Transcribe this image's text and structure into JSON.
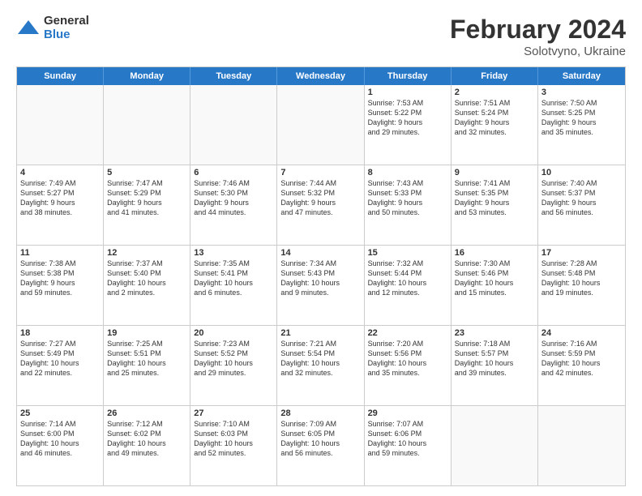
{
  "logo": {
    "general": "General",
    "blue": "Blue"
  },
  "title": {
    "month": "February 2024",
    "location": "Solotvyno, Ukraine"
  },
  "header_days": [
    "Sunday",
    "Monday",
    "Tuesday",
    "Wednesday",
    "Thursday",
    "Friday",
    "Saturday"
  ],
  "weeks": [
    [
      {
        "day": "",
        "info": ""
      },
      {
        "day": "",
        "info": ""
      },
      {
        "day": "",
        "info": ""
      },
      {
        "day": "",
        "info": ""
      },
      {
        "day": "1",
        "info": "Sunrise: 7:53 AM\nSunset: 5:22 PM\nDaylight: 9 hours\nand 29 minutes."
      },
      {
        "day": "2",
        "info": "Sunrise: 7:51 AM\nSunset: 5:24 PM\nDaylight: 9 hours\nand 32 minutes."
      },
      {
        "day": "3",
        "info": "Sunrise: 7:50 AM\nSunset: 5:25 PM\nDaylight: 9 hours\nand 35 minutes."
      }
    ],
    [
      {
        "day": "4",
        "info": "Sunrise: 7:49 AM\nSunset: 5:27 PM\nDaylight: 9 hours\nand 38 minutes."
      },
      {
        "day": "5",
        "info": "Sunrise: 7:47 AM\nSunset: 5:29 PM\nDaylight: 9 hours\nand 41 minutes."
      },
      {
        "day": "6",
        "info": "Sunrise: 7:46 AM\nSunset: 5:30 PM\nDaylight: 9 hours\nand 44 minutes."
      },
      {
        "day": "7",
        "info": "Sunrise: 7:44 AM\nSunset: 5:32 PM\nDaylight: 9 hours\nand 47 minutes."
      },
      {
        "day": "8",
        "info": "Sunrise: 7:43 AM\nSunset: 5:33 PM\nDaylight: 9 hours\nand 50 minutes."
      },
      {
        "day": "9",
        "info": "Sunrise: 7:41 AM\nSunset: 5:35 PM\nDaylight: 9 hours\nand 53 minutes."
      },
      {
        "day": "10",
        "info": "Sunrise: 7:40 AM\nSunset: 5:37 PM\nDaylight: 9 hours\nand 56 minutes."
      }
    ],
    [
      {
        "day": "11",
        "info": "Sunrise: 7:38 AM\nSunset: 5:38 PM\nDaylight: 9 hours\nand 59 minutes."
      },
      {
        "day": "12",
        "info": "Sunrise: 7:37 AM\nSunset: 5:40 PM\nDaylight: 10 hours\nand 2 minutes."
      },
      {
        "day": "13",
        "info": "Sunrise: 7:35 AM\nSunset: 5:41 PM\nDaylight: 10 hours\nand 6 minutes."
      },
      {
        "day": "14",
        "info": "Sunrise: 7:34 AM\nSunset: 5:43 PM\nDaylight: 10 hours\nand 9 minutes."
      },
      {
        "day": "15",
        "info": "Sunrise: 7:32 AM\nSunset: 5:44 PM\nDaylight: 10 hours\nand 12 minutes."
      },
      {
        "day": "16",
        "info": "Sunrise: 7:30 AM\nSunset: 5:46 PM\nDaylight: 10 hours\nand 15 minutes."
      },
      {
        "day": "17",
        "info": "Sunrise: 7:28 AM\nSunset: 5:48 PM\nDaylight: 10 hours\nand 19 minutes."
      }
    ],
    [
      {
        "day": "18",
        "info": "Sunrise: 7:27 AM\nSunset: 5:49 PM\nDaylight: 10 hours\nand 22 minutes."
      },
      {
        "day": "19",
        "info": "Sunrise: 7:25 AM\nSunset: 5:51 PM\nDaylight: 10 hours\nand 25 minutes."
      },
      {
        "day": "20",
        "info": "Sunrise: 7:23 AM\nSunset: 5:52 PM\nDaylight: 10 hours\nand 29 minutes."
      },
      {
        "day": "21",
        "info": "Sunrise: 7:21 AM\nSunset: 5:54 PM\nDaylight: 10 hours\nand 32 minutes."
      },
      {
        "day": "22",
        "info": "Sunrise: 7:20 AM\nSunset: 5:56 PM\nDaylight: 10 hours\nand 35 minutes."
      },
      {
        "day": "23",
        "info": "Sunrise: 7:18 AM\nSunset: 5:57 PM\nDaylight: 10 hours\nand 39 minutes."
      },
      {
        "day": "24",
        "info": "Sunrise: 7:16 AM\nSunset: 5:59 PM\nDaylight: 10 hours\nand 42 minutes."
      }
    ],
    [
      {
        "day": "25",
        "info": "Sunrise: 7:14 AM\nSunset: 6:00 PM\nDaylight: 10 hours\nand 46 minutes."
      },
      {
        "day": "26",
        "info": "Sunrise: 7:12 AM\nSunset: 6:02 PM\nDaylight: 10 hours\nand 49 minutes."
      },
      {
        "day": "27",
        "info": "Sunrise: 7:10 AM\nSunset: 6:03 PM\nDaylight: 10 hours\nand 52 minutes."
      },
      {
        "day": "28",
        "info": "Sunrise: 7:09 AM\nSunset: 6:05 PM\nDaylight: 10 hours\nand 56 minutes."
      },
      {
        "day": "29",
        "info": "Sunrise: 7:07 AM\nSunset: 6:06 PM\nDaylight: 10 hours\nand 59 minutes."
      },
      {
        "day": "",
        "info": ""
      },
      {
        "day": "",
        "info": ""
      }
    ]
  ]
}
